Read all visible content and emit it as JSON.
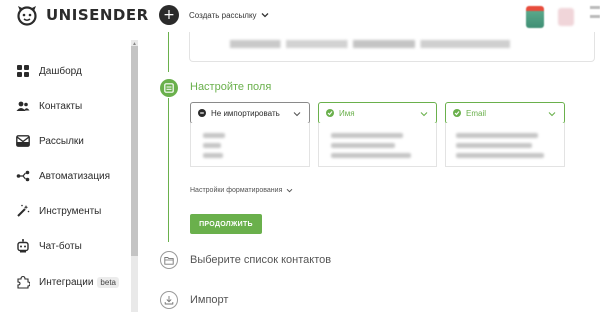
{
  "brand": {
    "name": "UNISENDER"
  },
  "topbar": {
    "create_label": "Создать рассылку"
  },
  "sidebar": {
    "items": [
      {
        "label": "Дашборд",
        "icon": "grid-icon"
      },
      {
        "label": "Контакты",
        "icon": "people-icon"
      },
      {
        "label": "Рассылки",
        "icon": "envelope-icon"
      },
      {
        "label": "Автоматизация",
        "icon": "automation-icon"
      },
      {
        "label": "Инструменты",
        "icon": "magic-wand-icon"
      },
      {
        "label": "Чат-боты",
        "icon": "robot-icon"
      },
      {
        "label": "Интеграции",
        "icon": "puzzle-icon",
        "badge": "beta"
      }
    ]
  },
  "steps": {
    "active": {
      "title": "Настройте поля",
      "icon": "list-icon"
    },
    "columns": [
      {
        "label": "Не импортировать",
        "state": "skip"
      },
      {
        "label": "Имя",
        "state": "mapped"
      },
      {
        "label": "Email",
        "state": "mapped"
      }
    ],
    "format_settings_label": "Настройки форматирования",
    "continue_label": "ПРОДОЛЖИТЬ",
    "next": [
      {
        "title": "Выберите список контактов",
        "icon": "folder-icon"
      },
      {
        "title": "Импорт",
        "icon": "download-icon"
      }
    ]
  },
  "colors": {
    "accent": "#6ab04c",
    "text": "#2b2b2b",
    "muted": "#555555"
  }
}
